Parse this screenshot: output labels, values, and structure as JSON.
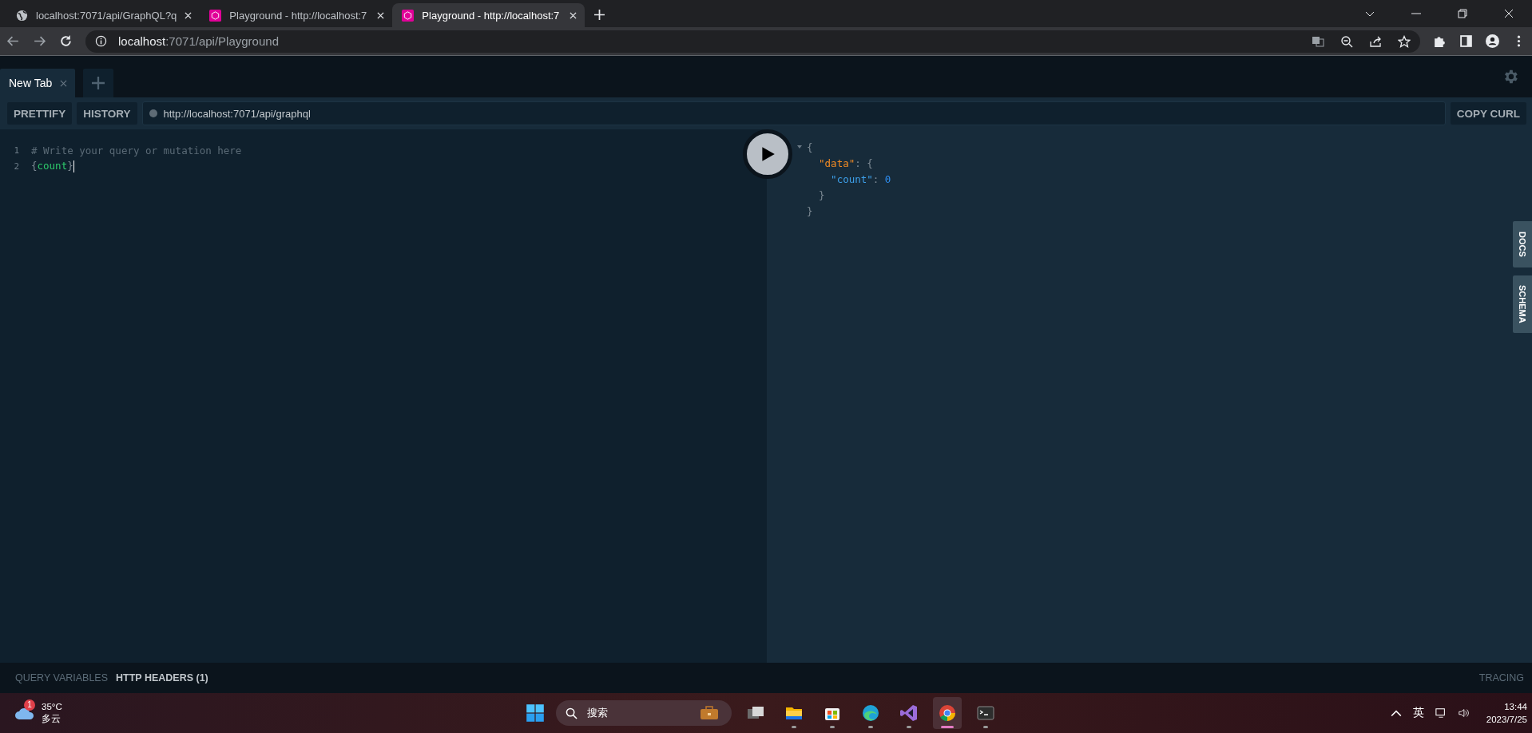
{
  "browser": {
    "tabs": [
      {
        "title": "localhost:7071/api/GraphQL?q",
        "kind": "globe",
        "selected": false
      },
      {
        "title": "Playground - http://localhost:7",
        "kind": "playground",
        "selected": false
      },
      {
        "title": "Playground - http://localhost:7",
        "kind": "playground",
        "selected": true
      }
    ],
    "address": {
      "host": "localhost",
      "path": ":7071/api/Playground"
    }
  },
  "playground": {
    "tabs": [
      {
        "label": "New Tab",
        "selected": true
      }
    ],
    "toolbar": [
      "PRETTIFY",
      "HISTORY"
    ],
    "endpoint": "http://localhost:7071/api/graphql",
    "copy": "COPY CURL",
    "editor": [
      {
        "number": "1",
        "tokens": [
          {
            "text": "# Write your query or mutation here",
            "kind": "comment"
          }
        ]
      },
      {
        "number": "2",
        "tokens": [
          {
            "text": "{",
            "kind": "punct"
          },
          {
            "text": "count",
            "kind": "field"
          },
          {
            "text": "}",
            "kind": "punct"
          }
        ]
      }
    ],
    "result": [
      {
        "tokens": [
          {
            "text": "{",
            "kind": "punct"
          }
        ]
      },
      {
        "tokens": [
          {
            "text": "  \"data\"",
            "kind": "key"
          },
          {
            "text": ": {",
            "kind": "punct"
          }
        ]
      },
      {
        "tokens": [
          {
            "text": "    \"count\"",
            "kind": "prop"
          },
          {
            "text": ": ",
            "kind": "punct"
          },
          {
            "text": "0",
            "kind": "number"
          }
        ]
      },
      {
        "tokens": [
          {
            "text": "  }",
            "kind": "punct"
          }
        ]
      },
      {
        "tokens": [
          {
            "text": "}",
            "kind": "punct"
          }
        ]
      }
    ],
    "side_tabs": [
      "DOCS",
      "SCHEMA"
    ],
    "bottom_tabs": [
      {
        "label": "QUERY VARIABLES",
        "selected": false
      },
      {
        "label": "HTTP HEADERS (1)",
        "selected": true
      }
    ],
    "tracing": "TRACING"
  },
  "taskbar": {
    "weather": {
      "badge": "1",
      "temp": "35°C",
      "condition": "多云"
    },
    "search": {
      "placeholder": "搜索"
    },
    "apps": [
      {
        "kind": "taskview",
        "running": false,
        "selected": false
      },
      {
        "kind": "folder",
        "running": true,
        "selected": false
      },
      {
        "kind": "store",
        "running": true,
        "selected": false
      },
      {
        "kind": "edge",
        "running": true,
        "selected": false
      },
      {
        "kind": "vs",
        "running": true,
        "selected": false
      },
      {
        "kind": "chrome",
        "running": true,
        "selected": true
      },
      {
        "kind": "terminal",
        "running": true,
        "selected": false
      }
    ],
    "ime": "英",
    "time": "13:44",
    "date": "2023/7/25"
  }
}
